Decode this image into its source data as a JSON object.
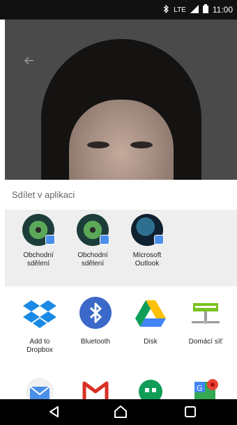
{
  "status": {
    "time": "11:00",
    "network": "LTE",
    "icons": [
      "bluetooth-icon",
      "signal-icon",
      "battery-icon"
    ]
  },
  "share": {
    "title": "Sdílet v aplikaci",
    "recent": [
      {
        "label_line1": "Obchodní",
        "label_line2": "sdělení",
        "icon": "messaging-avatar-icon"
      },
      {
        "label_line1": "Obchodní",
        "label_line2": "sdělení",
        "icon": "messaging-avatar-icon"
      },
      {
        "label_line1": "Microsoft",
        "label_line2": "Outlook",
        "icon": "outlook-avatar-icon"
      }
    ],
    "apps": [
      {
        "label_line1": "Add to",
        "label_line2": "Dropbox",
        "icon": "dropbox-icon"
      },
      {
        "label_line1": "Bluetooth",
        "label_line2": "",
        "icon": "bluetooth-icon"
      },
      {
        "label_line1": "Disk",
        "label_line2": "",
        "icon": "google-drive-icon"
      },
      {
        "label_line1": "Domácí síť",
        "label_line2": "",
        "icon": "home-network-icon"
      }
    ],
    "more_apps": [
      "email-icon",
      "gmail-icon",
      "hangouts-icon",
      "maps-icon"
    ]
  },
  "nav": {
    "back": "back-icon",
    "home": "home-icon",
    "recents": "recents-icon"
  },
  "colors": {
    "dropbox": "#1a8ae6",
    "bluetooth": "#3b69c9",
    "gmail": "#d93025",
    "hangouts": "#0f9d58",
    "sheet_bg": "#eeeeee"
  }
}
